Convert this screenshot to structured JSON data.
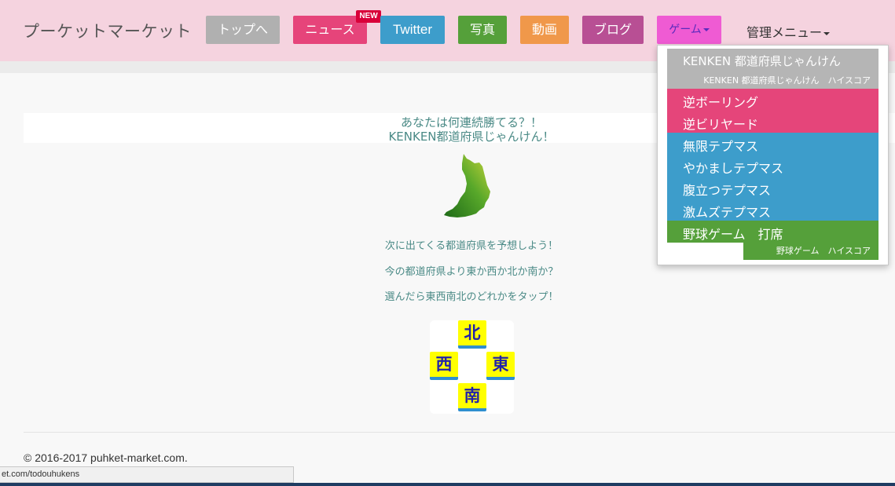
{
  "brand": "プーケットマーケット",
  "nav": {
    "top": "トップへ",
    "news": "ニュース",
    "news_badge": "NEW",
    "twitter": "Twitter",
    "photo": "写真",
    "video": "動画",
    "blog": "ブログ",
    "game": "ゲーム",
    "admin": "管理メニュー"
  },
  "dropdown": {
    "kenken": "KENKEN 都道府県じゃんけん",
    "kenken_highscore": "KENKEN 都道府県じゃんけん　ハイスコア",
    "reverse_bowling": "逆ボーリング",
    "reverse_billiards": "逆ビリヤード",
    "infinite_tepumasu": "無限テプマス",
    "noisy_tepumasu": "やかましテプマス",
    "angry_tepumasu": "腹立つテプマス",
    "hard_tepumasu": "激ムズテプマス",
    "baseball_batting": "野球ゲーム　打席",
    "baseball_highscore": "野球ゲーム　ハイスコア"
  },
  "main": {
    "headline1": "あなたは何連続勝てる？！",
    "headline2": "KENKEN都道府県じゃんけん！",
    "hint1": "次に出てくる都道府県を予想しよう！",
    "hint2": "今の都道府県より東か西か北か南か？",
    "hint3": "選んだら東西南北のどれかをタップ！",
    "north": "北",
    "west": "西",
    "east": "東",
    "south": "南"
  },
  "footer": {
    "copyright": "© 2016-2017 puhket-market.com."
  },
  "statusbar": {
    "url": "et.com/todouhukens"
  },
  "colors": {
    "navbar_bg": "#f5d3df",
    "gray_btn": "#b0b0b0",
    "pink": "#e6447a",
    "blue": "#3d9dcb",
    "green": "#55a03a",
    "orange": "#f0984a",
    "purple": "#b84f94",
    "game_pink": "#ef5bd3",
    "teal_text": "#4a8a86",
    "tile_yellow": "#ffff00"
  }
}
